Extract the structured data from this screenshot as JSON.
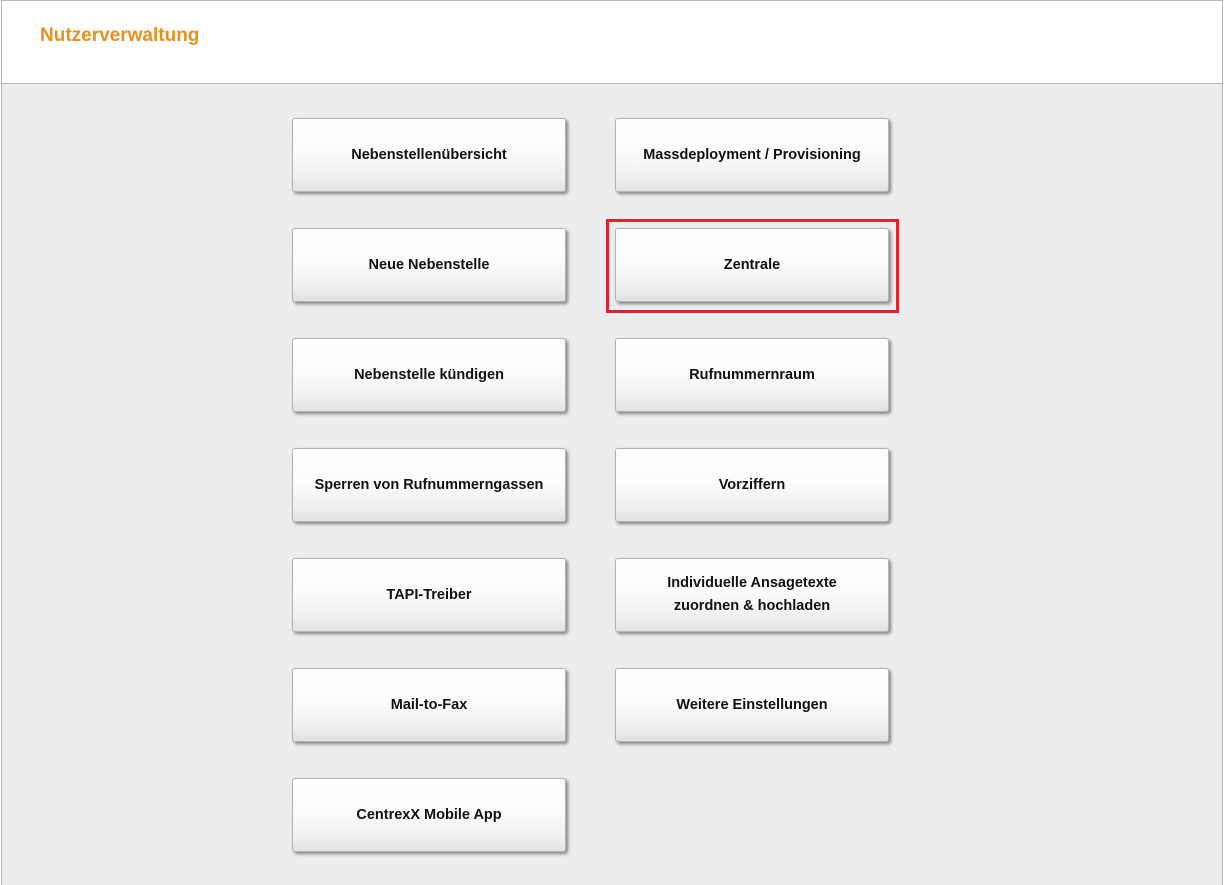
{
  "header": {
    "title": "Nutzerverwaltung"
  },
  "colors": {
    "title": "#e8901d",
    "content_background": "#ededed",
    "highlight_border": "#e0232f"
  },
  "tiles_left": [
    {
      "label": "Nebenstellenübersicht"
    },
    {
      "label": "Neue Nebenstelle"
    },
    {
      "label": "Nebenstelle kündigen"
    },
    {
      "label": "Sperren von Rufnummerngassen"
    },
    {
      "label": "TAPI-Treiber"
    },
    {
      "label": "Mail-to-Fax"
    },
    {
      "label": "CentrexX Mobile App"
    }
  ],
  "tiles_right": [
    {
      "label": "Massdeployment / Provisioning"
    },
    {
      "label": "Zentrale",
      "highlighted": true
    },
    {
      "label": "Rufnummernraum"
    },
    {
      "label": "Vorziffern"
    },
    {
      "label": "Individuelle Ansagetexte\nzuordnen & hochladen"
    },
    {
      "label": "Weitere Einstellungen"
    }
  ]
}
